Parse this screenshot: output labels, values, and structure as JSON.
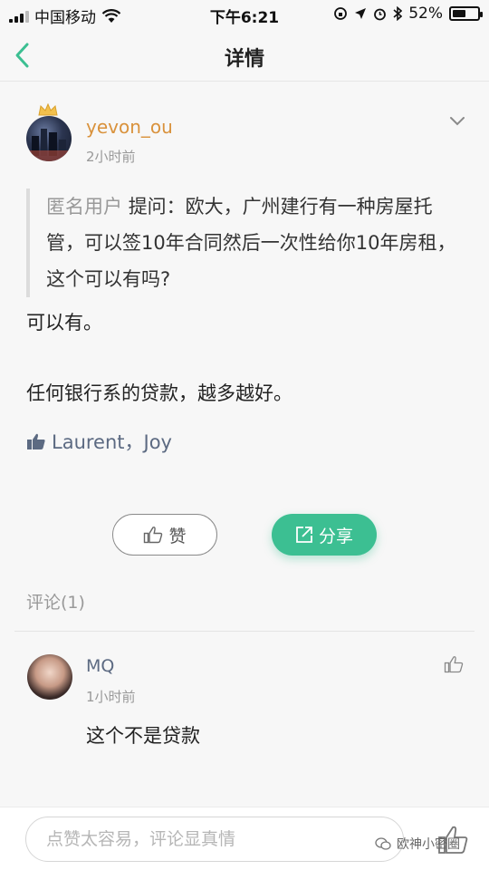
{
  "status_bar": {
    "carrier": "中国移动",
    "time": "下午6:21",
    "battery": "52%",
    "battery_level": 0.52
  },
  "nav": {
    "title": "详情"
  },
  "post": {
    "author": "yevon_ou",
    "time": "2小时前",
    "question_user": "匿名用户",
    "question_text": "提问：欧大，广州建行有一种房屋托管，可以签10年合同然后一次性给你10年房租，这个可以有吗?",
    "reply_line1": "可以有。",
    "reply_line2": "任何银行系的贷款，越多越好。",
    "likes": "Laurent，Joy"
  },
  "buttons": {
    "like_label": "赞",
    "share_label": "分享"
  },
  "comments": {
    "heading": "评论(1)",
    "items": [
      {
        "name": "MQ",
        "time": "1小时前",
        "text": "这个不是贷款"
      }
    ]
  },
  "footer": {
    "placeholder": "点赞太容易，评论显真情",
    "watermark": "欧神小密圈"
  },
  "colors": {
    "accent": "#3cbf92",
    "author": "#d9923c",
    "link": "#5c6a82"
  }
}
